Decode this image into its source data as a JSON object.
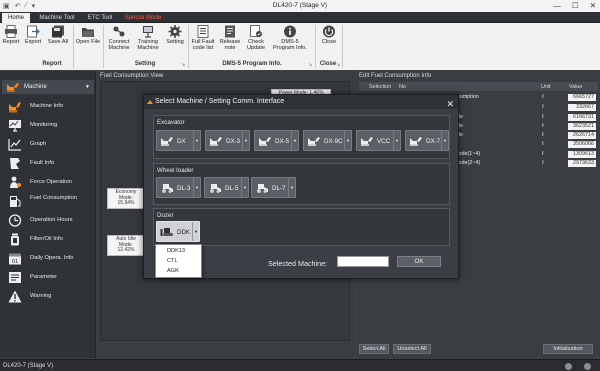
{
  "window": {
    "title": "DL420-7 (Stage V)",
    "quick_access": [
      "▣",
      "↶",
      "∕",
      "▾"
    ],
    "controls": [
      "—",
      "☐",
      "✕"
    ]
  },
  "tabs": [
    {
      "label": "Home",
      "active": true
    },
    {
      "label": "Machine Tool",
      "active": false
    },
    {
      "label": "ETC Tool",
      "active": false
    },
    {
      "label": "Special Mode",
      "active": false,
      "color": "#ff5a3c"
    }
  ],
  "ribbon": {
    "buttons": [
      {
        "label": "Report",
        "icon": "printer-icon"
      },
      {
        "label": "Export",
        "icon": "export-icon"
      },
      {
        "label": "Save All",
        "icon": "save-all-icon"
      },
      {
        "label": "Open File",
        "icon": "open-folder-icon"
      },
      {
        "label": "Connect Machine",
        "icon": "connect-icon"
      },
      {
        "label": "Training Machine",
        "icon": "training-icon"
      },
      {
        "label": "Setting",
        "icon": "gear-icon"
      },
      {
        "label": "Full Fault code list",
        "icon": "fault-list-icon"
      },
      {
        "label": "Release note",
        "icon": "release-note-icon"
      },
      {
        "label": "Check Update",
        "icon": "check-update-icon"
      },
      {
        "label": "DMS-5 Program Info.",
        "icon": "info-icon"
      },
      {
        "label": "Close",
        "icon": "power-icon"
      }
    ],
    "groups": {
      "report": "Report",
      "setting": "Setting",
      "program_info": "DMS-5 Program Info.",
      "close": "Close"
    }
  },
  "sidebar": {
    "machine_label": "Machine",
    "items": [
      {
        "label": "Machine Info",
        "icon": "excavator-icon"
      },
      {
        "label": "Monitoring",
        "icon": "monitor-icon"
      },
      {
        "label": "Graph",
        "icon": "graph-icon"
      },
      {
        "label": "Fault Info",
        "icon": "fault-icon"
      },
      {
        "label": "Force Operation",
        "icon": "force-operation-icon"
      },
      {
        "label": "Fuel Consumption",
        "icon": "fuel-icon"
      },
      {
        "label": "Operation Hours",
        "icon": "clock-icon"
      },
      {
        "label": "Filter/Oil Info",
        "icon": "filter-oil-icon"
      },
      {
        "label": "Daily Opera. Info",
        "icon": "calendar-icon"
      },
      {
        "label": "Parameter",
        "icon": "parameter-icon"
      },
      {
        "label": "Warning",
        "icon": "warning-icon"
      }
    ],
    "calendar_day": "01"
  },
  "view_panel": {
    "title": "Fuel Consumption View",
    "callouts": {
      "power": "Power Mode: 1.46%",
      "economy": "Economy Mode: 15.94%",
      "auto_idle": "Auto Idle Mode: 12.42%"
    }
  },
  "edit_panel": {
    "title": "Edit Fuel Consumption Info",
    "columns": {
      "selection": "Selection",
      "no": "No",
      "unit": "Unit",
      "value": "Value"
    },
    "rows": [
      {
        "label": "nsumption",
        "unit": "ℓ",
        "value": "6665727"
      },
      {
        "label": "",
        "unit": "ℓ",
        "value": "332667"
      },
      {
        "label": "ode",
        "unit": "ℓ",
        "value": "6166731"
      },
      {
        "label": "ode",
        "unit": "ℓ",
        "value": "3623521"
      },
      {
        "label": "ode",
        "unit": "ℓ",
        "value": "2626714"
      },
      {
        "label": "e",
        "unit": "ℓ",
        "value": "3506066"
      },
      {
        "label": "Mode(1~4)",
        "unit": "ℓ",
        "value": "1309613"
      },
      {
        "label": "Mode(2~4)",
        "unit": "ℓ",
        "value": "2973633"
      }
    ],
    "select_all": "Select All",
    "unselect_all": "Unselect All",
    "initialization": "Initialization"
  },
  "statusbar": {
    "text": "DL420-7 (Stage V)"
  },
  "dialog": {
    "title": "Select Machine / Setting Comm. Interface",
    "close": "✕",
    "groups": {
      "excavator": {
        "label": "Excavator",
        "machines": [
          "DX",
          "DX-3",
          "DX-5",
          "DX-9C",
          "VCC",
          "DX-7"
        ]
      },
      "wheel_loader": {
        "label": "Wheel loader",
        "machines": [
          "DL-3",
          "DL-5",
          "DL-7"
        ]
      },
      "dozer": {
        "label": "Dozer",
        "machines": [
          "DDK"
        ]
      }
    },
    "selected_label": "Selected Machine:",
    "selected_value": "",
    "ok": "OK",
    "dropdown_items": [
      "DDK13",
      "CTL",
      "AGK"
    ],
    "dropdown_arrow": "▾"
  },
  "colors": {
    "accent_orange": "#ff8c1a",
    "special_mode": "#ff5a3c",
    "dark_bg": "#3c3f44"
  }
}
